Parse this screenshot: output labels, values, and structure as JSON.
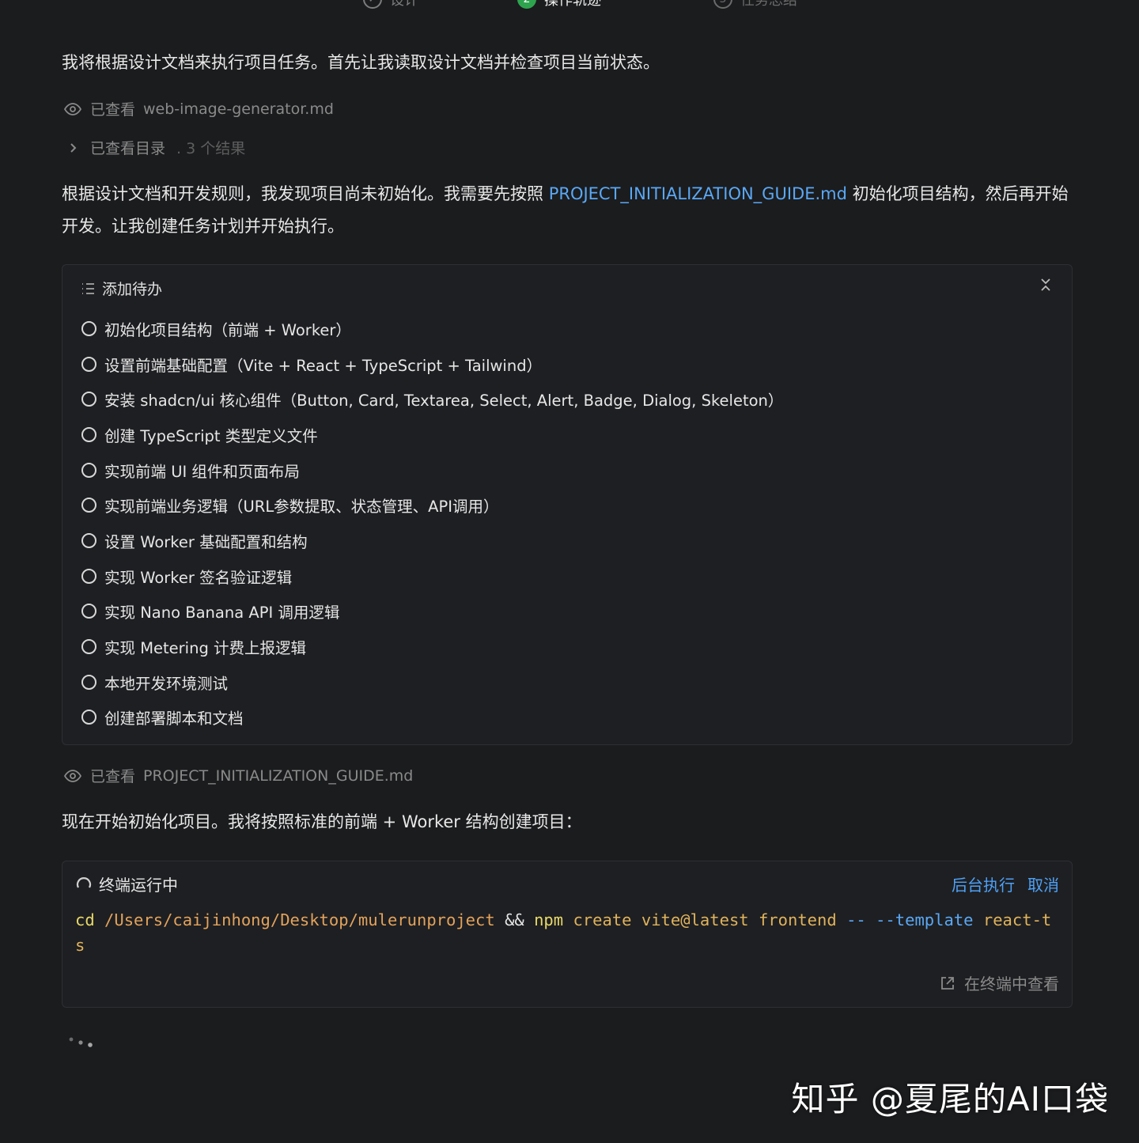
{
  "stepper": {
    "steps": [
      {
        "label": "设计",
        "number": "✓",
        "state": "done"
      },
      {
        "label": "操作轨迹",
        "number": "2",
        "state": "active"
      },
      {
        "label": "任务总结",
        "number": "3",
        "state": "todo"
      }
    ]
  },
  "messages": {
    "intro": "我将根据设计文档来执行项目任务。首先让我读取设计文档并检查项目当前状态。",
    "viewed_file_1": {
      "label": "已查看",
      "file": "web-image-generator.md"
    },
    "viewed_dir": {
      "label": "已查看目录",
      "results": ". 3 个结果"
    },
    "plan": {
      "before": "根据设计文档和开发规则，我发现项目尚未初始化。我需要先按照 ",
      "link": "PROJECT_INITIALIZATION_GUIDE.md",
      "after": " 初始化项目结构，然后再开始开发。让我创建任务计划并开始执行。"
    },
    "viewed_file_2": {
      "label": "已查看",
      "file": "PROJECT_INITIALIZATION_GUIDE.md"
    },
    "start": "现在开始初始化项目。我将按照标准的前端 + Worker 结构创建项目："
  },
  "todo_panel": {
    "title": "添加待办",
    "items": [
      "初始化项目结构（前端 + Worker）",
      "设置前端基础配置（Vite + React + TypeScript + Tailwind）",
      "安装 shadcn/ui 核心组件（Button, Card, Textarea, Select, Alert, Badge, Dialog, Skeleton）",
      "创建 TypeScript 类型定义文件",
      "实现前端 UI 组件和页面布局",
      "实现前端业务逻辑（URL参数提取、状态管理、API调用）",
      "设置 Worker 基础配置和结构",
      "实现 Worker 签名验证逻辑",
      "实现 Nano Banana API 调用逻辑",
      "实现 Metering 计费上报逻辑",
      "本地开发环境测试",
      "创建部署脚本和文档"
    ]
  },
  "terminal": {
    "status": "终端运行中",
    "background_label": "后台执行",
    "cancel_label": "取消",
    "command": {
      "cmd1": "cd",
      "path": "/Users/caijinhong/Desktop/mulerunproject",
      "op": "&&",
      "cmd2": "npm",
      "args": "create vite@latest frontend",
      "flags": "-- --template",
      "tail": "react-ts"
    },
    "open_label": "在终端中查看"
  },
  "watermark": "知乎 @夏尾的AI口袋",
  "colors": {
    "background": "#1b1c1e",
    "link": "#5aa8f5",
    "active_step": "#2ea44f",
    "action": "#4ea1f7"
  }
}
